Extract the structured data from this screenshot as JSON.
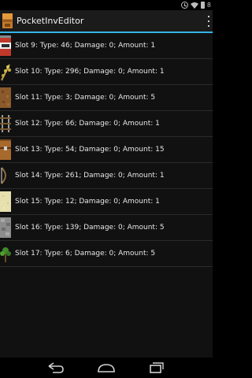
{
  "status_bar": {
    "time": "8"
  },
  "app": {
    "title": "PocketInvEditor"
  },
  "slots": [
    {
      "label": "Slot 9: Type: 46; Damage: 0; Amount: 1",
      "icon": "tnt-block-icon"
    },
    {
      "label": "Slot 10: Type: 296; Damage: 0; Amount: 1",
      "icon": "wheat-icon"
    },
    {
      "label": "Slot 11: Type: 3; Damage: 0; Amount: 5",
      "icon": "dirt-block-icon"
    },
    {
      "label": "Slot 12: Type: 66; Damage: 0; Amount: 1",
      "icon": "rail-icon"
    },
    {
      "label": "Slot 13: Type: 54; Damage: 0; Amount: 15",
      "icon": "chest-icon"
    },
    {
      "label": "Slot 14: Type: 261; Damage: 0; Amount: 1",
      "icon": "bow-icon"
    },
    {
      "label": "Slot 15: Type: 12; Damage: 0; Amount: 1",
      "icon": "sand-block-icon"
    },
    {
      "label": "Slot 16: Type: 139; Damage: 0; Amount: 5",
      "icon": "cobblestone-wall-icon"
    },
    {
      "label": "Slot 17: Type: 6; Damage: 0; Amount: 5",
      "icon": "sapling-icon"
    }
  ],
  "colors": {
    "accent": "#33b5e5",
    "action_bar": "#1b1b1b",
    "list_background": "#111111"
  }
}
